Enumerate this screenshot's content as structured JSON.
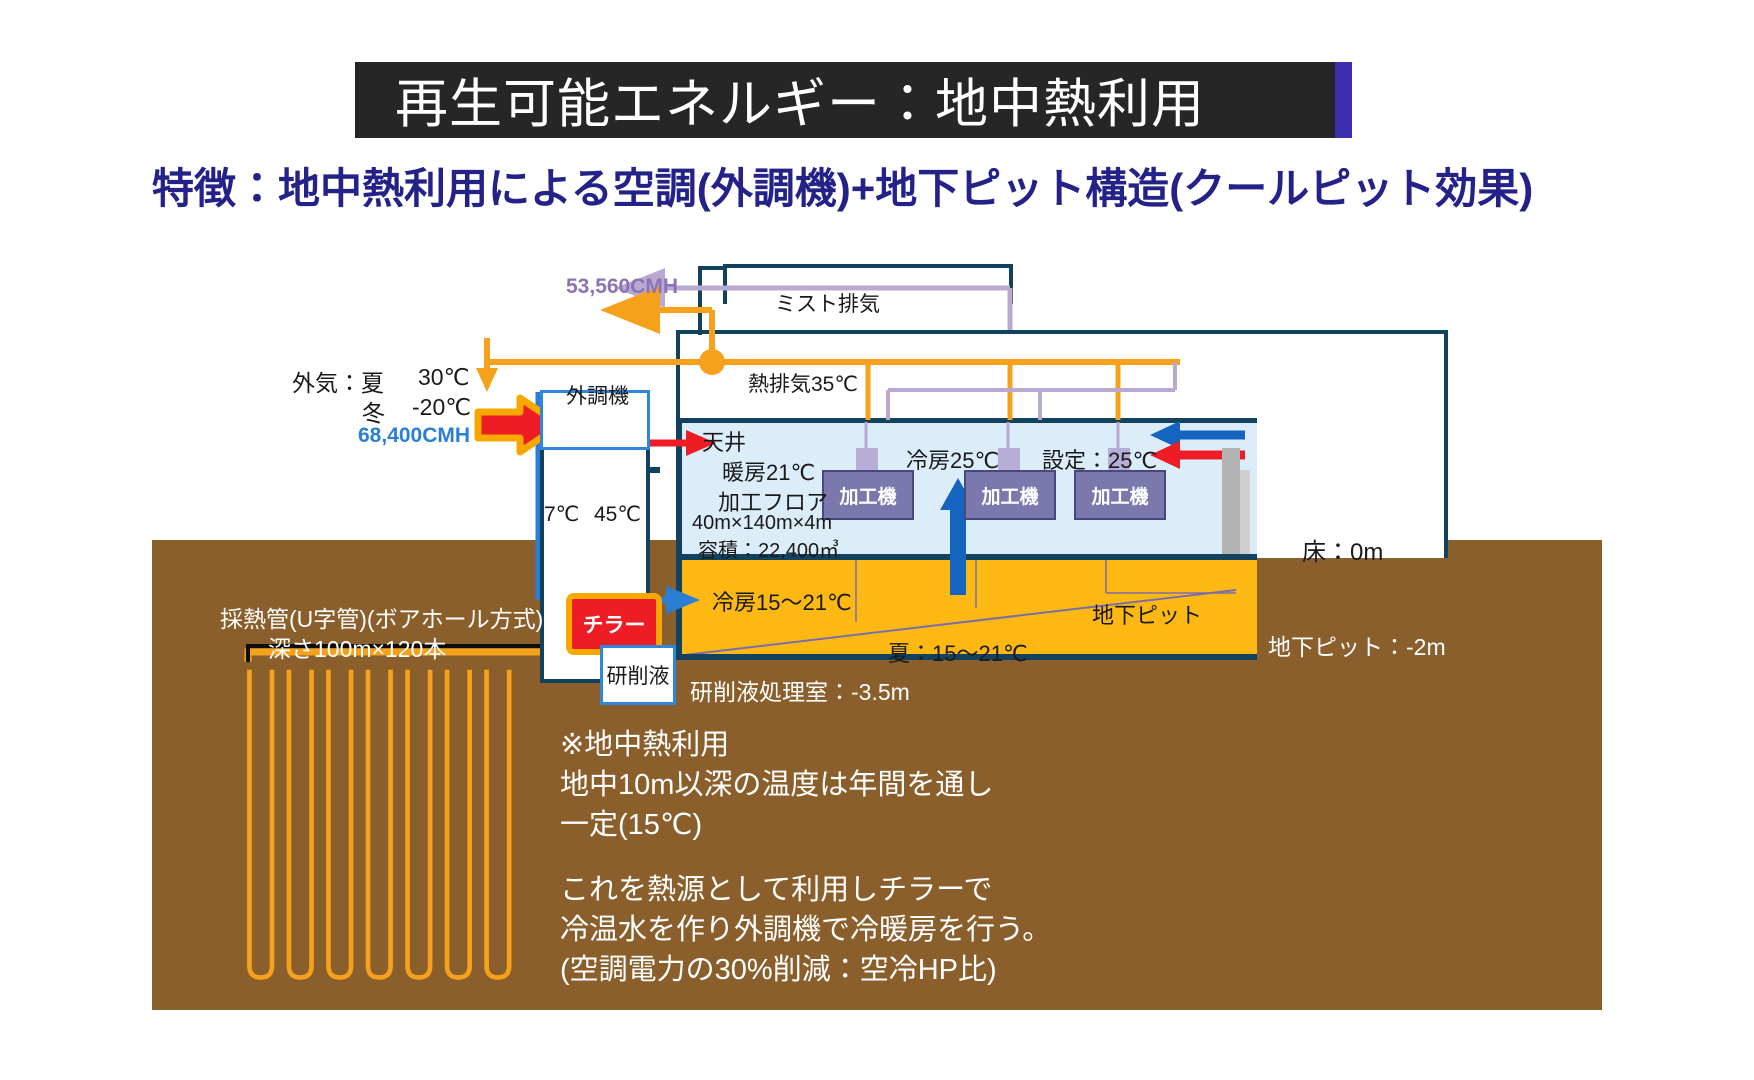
{
  "title": {
    "text": "再生可能エネルギー：地中熱利用",
    "accent_left_color": "#2e86de",
    "accent_right_color": "#3b2fb0",
    "bg_color": "#262626"
  },
  "subtitle": {
    "text": "特徴：地中熱利用による空調(外調機)+地下ピット構造(クールピット効果)",
    "color": "#242289"
  },
  "diagram": {
    "exhaust_flow": "53,560CMH",
    "mist_exhaust": "ミスト排気",
    "hot_exhaust": "熱排気35℃",
    "outside_air_label": "外気：夏",
    "outside_air_summer": "30℃",
    "outside_air_winter_label": "冬",
    "outside_air_winter": "-20℃",
    "intake_flow": "68,400CMH",
    "ahu": "外調機",
    "chiller": "チラー",
    "chiller_cold": "7℃",
    "chiller_hot": "45℃",
    "grinding_fluid": "研削液",
    "grinding_room": "研削液処理室：-3.5m",
    "ceiling": "天井",
    "heating": "暖房21℃",
    "cooling_room": "冷房25℃",
    "setpoint": "設定：25℃",
    "floor_name": "加工フロア",
    "floor_dims": "40m×140m×4m",
    "floor_volume": "容積：22,400㎥",
    "machines": [
      "加工機",
      "加工機",
      "加工機"
    ],
    "pit_cooling": "冷房15〜21℃",
    "pit_label": "地下ピット",
    "pit_summer": "夏：15〜21℃",
    "floor_level": "床：0m",
    "pit_level": "地下ピット：-2m",
    "borehole_title": "採熱管(U字管)(ボアホール方式)",
    "borehole_spec": "深さ100m×120本"
  },
  "notes": {
    "note1": "※地中熱利用\n地中10m以深の温度は年間を通し\n一定(15℃)",
    "note2": "これを熱源として利用しチラーで\n冷温水を作り外調機で冷暖房を行う。\n(空調電力の30%削減：空冷HP比)"
  },
  "colors": {
    "ground": "#8a5f2b",
    "pit": "#fdb813",
    "interior": "#dcedfa",
    "shell": "#13425e",
    "orange": "#f5a11c",
    "purple_pipe": "#b9a8d0",
    "red_pipe": "#ee1c25",
    "blue_pipe": "#2a7fd4"
  }
}
